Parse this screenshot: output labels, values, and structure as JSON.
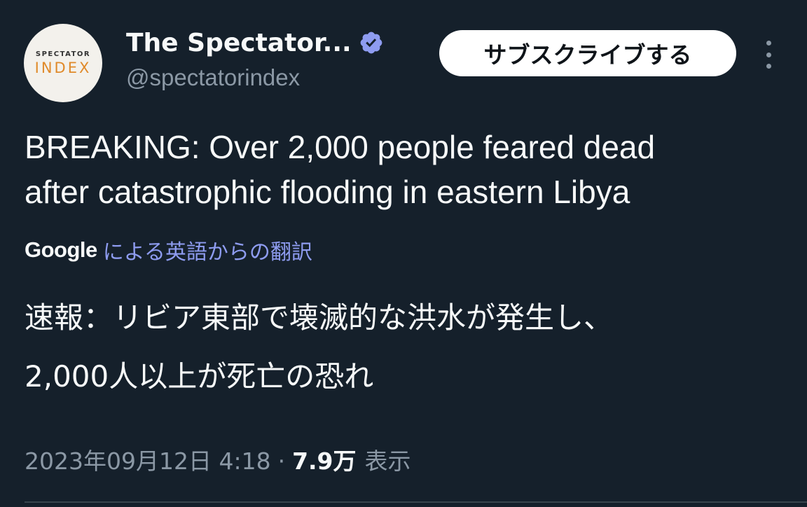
{
  "account": {
    "avatar_logo_top": "SPECTATOR",
    "avatar_logo_bottom": "INDEX",
    "display_name": "The Spectator...",
    "handle": "@spectatorindex",
    "verified_icon": "verified-badge-icon"
  },
  "actions": {
    "subscribe_label": "サブスクライブする",
    "more_icon": "more-vertical-icon"
  },
  "tweet": {
    "text_line1": "BREAKING: Over 2,000 people feared dead",
    "text_line2": "after catastrophic flooding in eastern Libya"
  },
  "translation": {
    "provider": "Google",
    "link_label": "による英語からの翻訳",
    "text_line1": "速報：リビア東部で壊滅的な洪水が発生し、",
    "text_line2": "2,000人以上が死亡の恐れ"
  },
  "meta": {
    "timestamp": "2023年09月12日 4:18",
    "separator": "·",
    "views_count": "7.9万",
    "views_label": "表示"
  },
  "colors": {
    "background": "#15202b",
    "primary_text": "#f7f9f9",
    "secondary_text": "#8b98a5",
    "verified": "#8e9cf0",
    "translation_link": "#8e9cf0"
  }
}
